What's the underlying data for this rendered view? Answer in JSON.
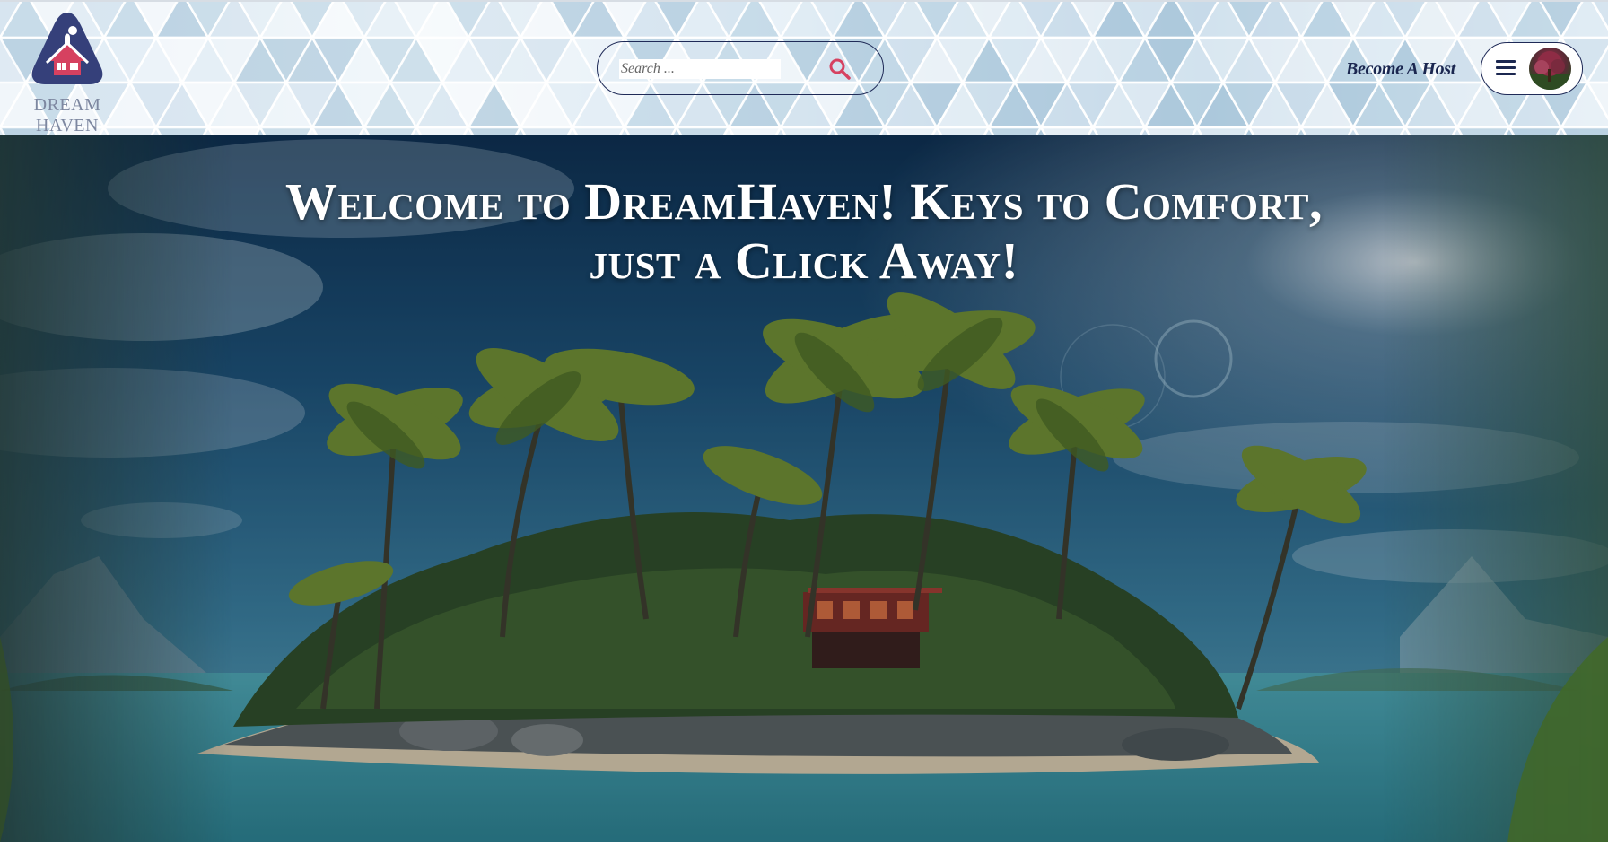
{
  "header": {
    "logo_text": "DREAM HAVEN",
    "search": {
      "placeholder": "Search ...",
      "value": "",
      "icon": "search-icon"
    },
    "become_host_label": "Become A Host",
    "menu_icon": "hamburger-menu-icon",
    "avatar_icon": "avatar"
  },
  "hero": {
    "heading_line1": "Welcome to DreamHaven! Keys to Comfort,",
    "heading_line2": "just a Click Away!"
  },
  "colors": {
    "brand_navy": "#1f2a57",
    "accent_red": "#d64160",
    "logo_purple": "#3a3a7a"
  }
}
